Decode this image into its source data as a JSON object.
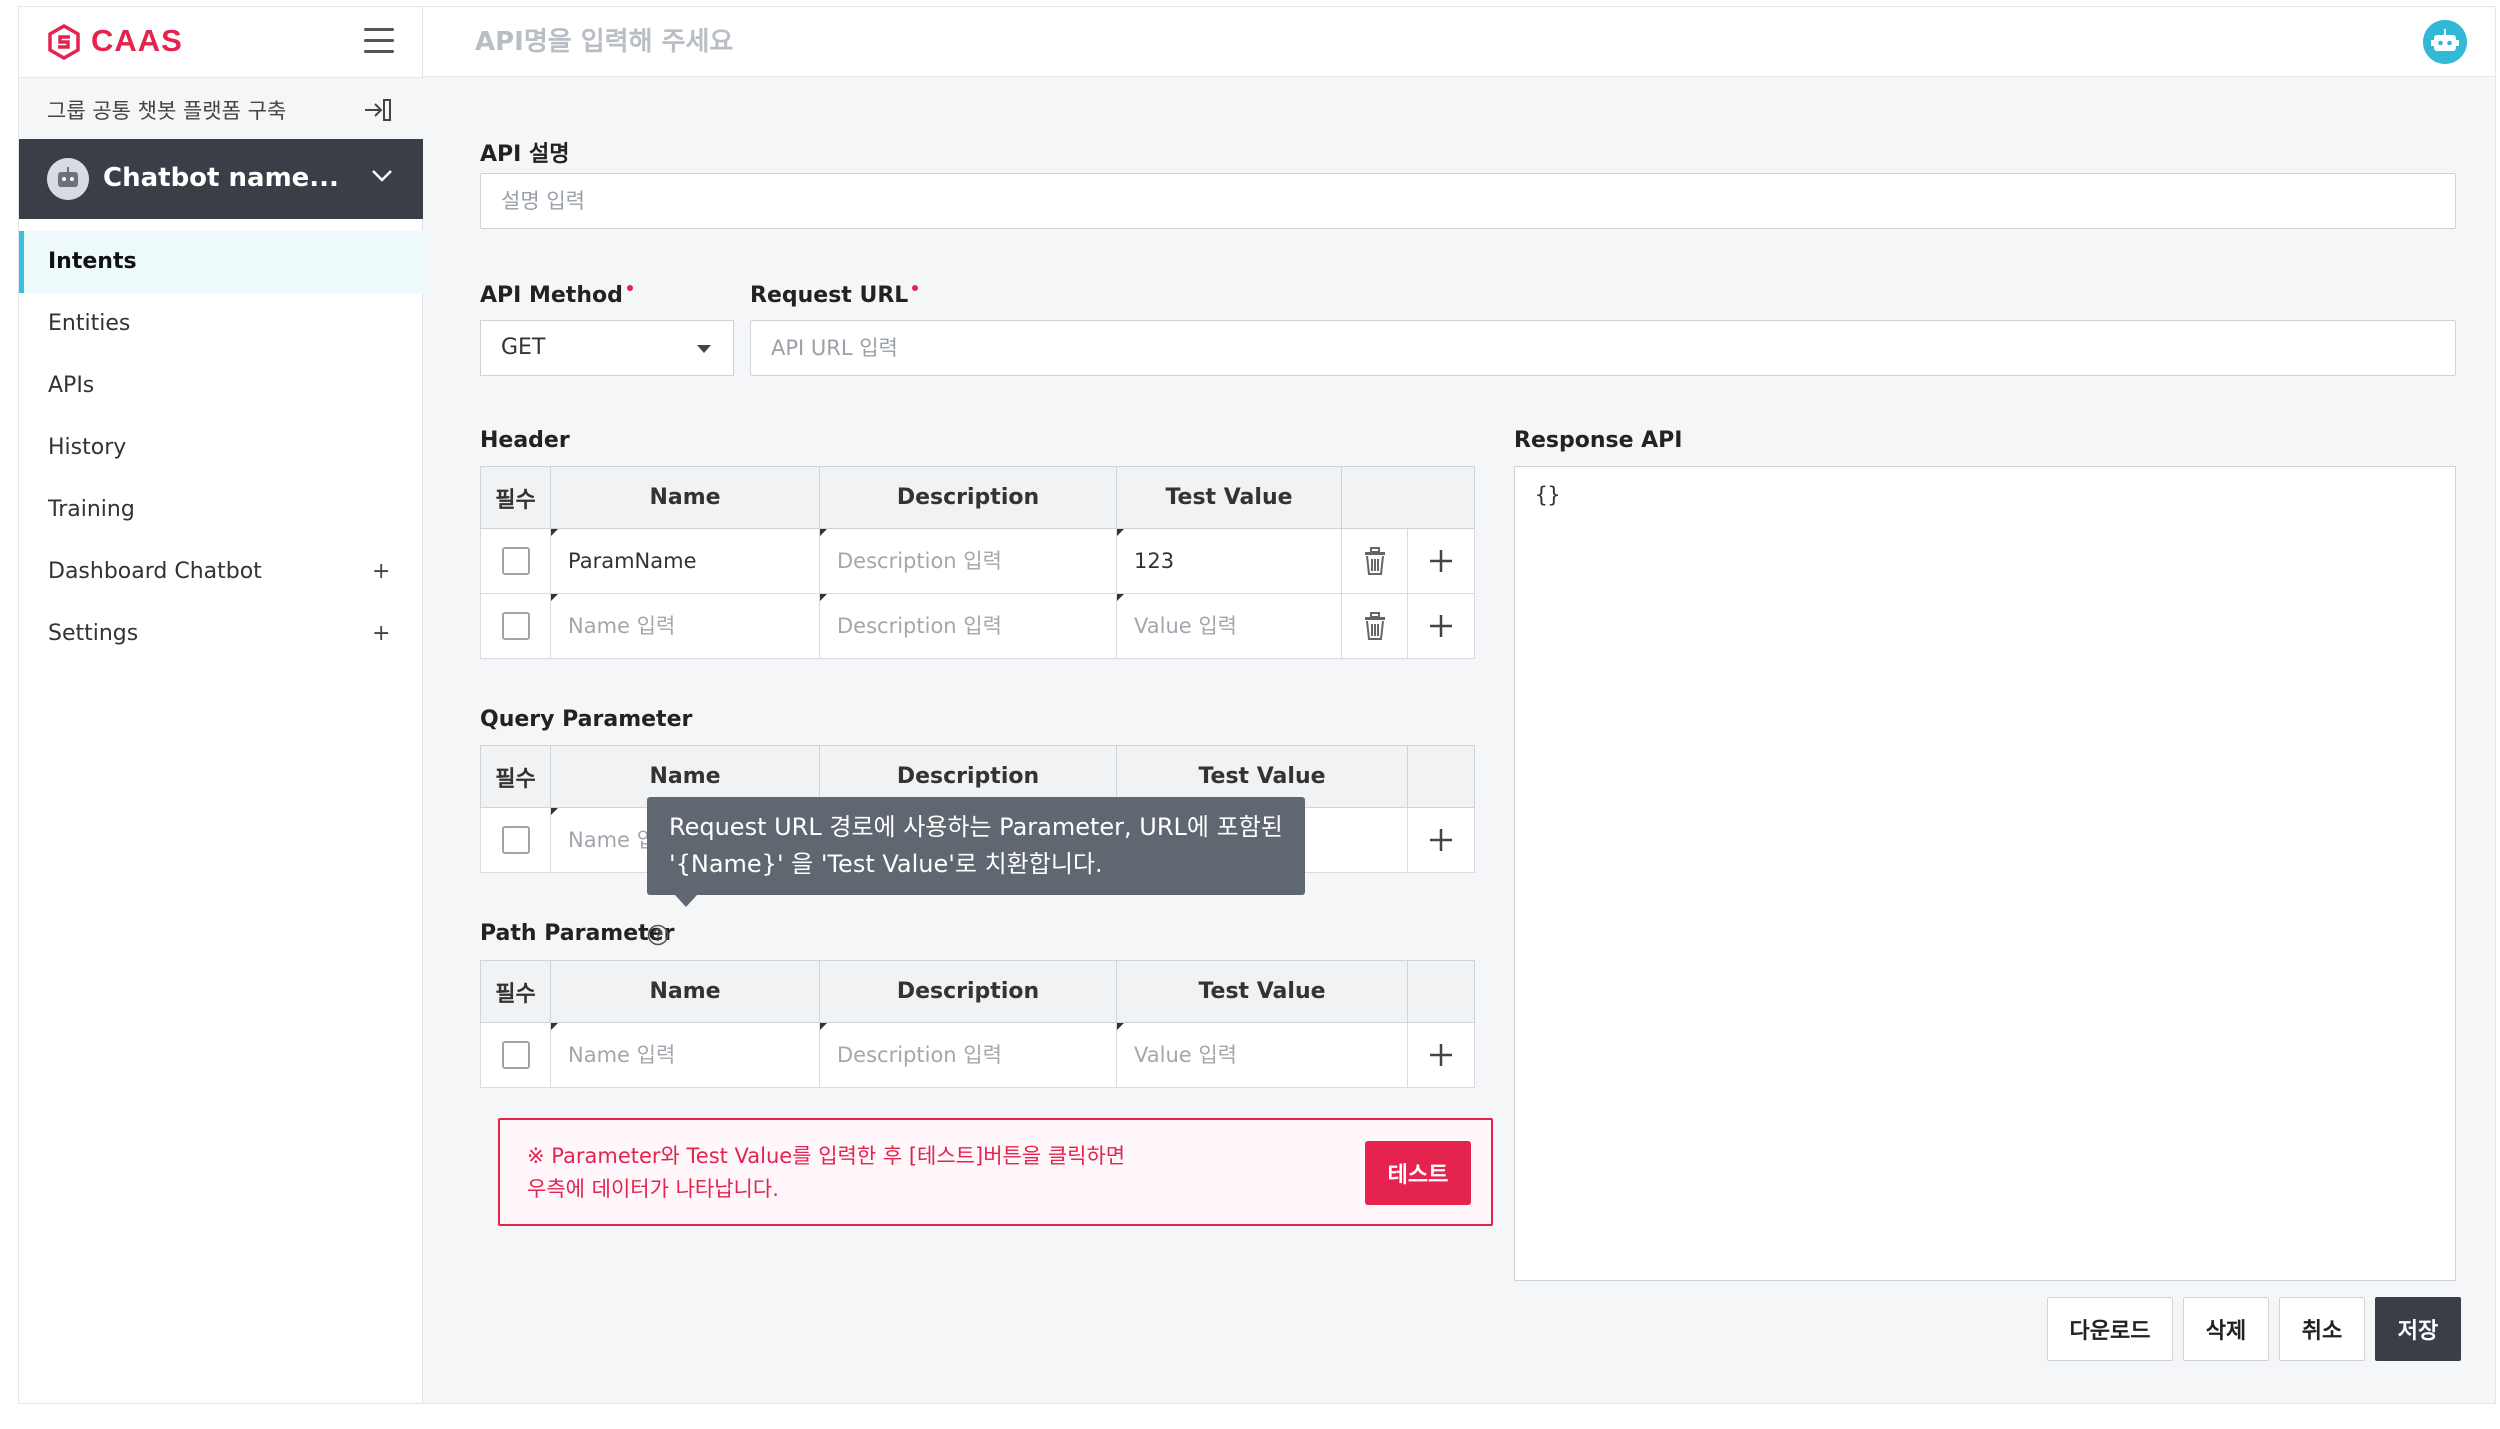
{
  "brand": {
    "name": "CAAS",
    "accent": "#e4234f"
  },
  "sidebar": {
    "project_name": "그룹 공통 챗봇 플랫폼 구축",
    "chatbot_name": "Chatbot name...",
    "items": [
      {
        "label": "Intents",
        "active": true,
        "expandable": false
      },
      {
        "label": "Entities",
        "active": false,
        "expandable": false
      },
      {
        "label": "APIs",
        "active": false,
        "expandable": false
      },
      {
        "label": "History",
        "active": false,
        "expandable": false
      },
      {
        "label": "Training",
        "active": false,
        "expandable": false
      },
      {
        "label": "Dashboard Chatbot",
        "active": false,
        "expandable": true,
        "plus": "+"
      },
      {
        "label": "Settings",
        "active": false,
        "expandable": true,
        "plus": "+"
      }
    ]
  },
  "header": {
    "api_name_placeholder": "API명을 입력해 주세요"
  },
  "form": {
    "description_label": "API 설명",
    "description_placeholder": "설명 입력",
    "method_label": "API Method",
    "method_value": "GET",
    "url_label": "Request URL",
    "url_placeholder": "API URL 입력"
  },
  "columns": {
    "required": "필수",
    "name": "Name",
    "description": "Description",
    "test_value": "Test Value"
  },
  "header_params": {
    "title": "Header",
    "rows": [
      {
        "name": "ParamName",
        "description": "",
        "value": "123"
      },
      {
        "name": "",
        "description": "",
        "value": ""
      }
    ]
  },
  "query_params": {
    "title": "Query Parameter",
    "rows": [
      {
        "name": "",
        "description": "",
        "value": ""
      }
    ]
  },
  "path_params": {
    "title": "Path Parameter",
    "rows": [
      {
        "name": "",
        "description": "",
        "value": ""
      }
    ]
  },
  "placeholders": {
    "name": "Name 입력",
    "description": "Description 입력",
    "value": "Value 입력"
  },
  "tooltip": {
    "line1": "Request URL 경로에 사용하는 Parameter, URL에 포함된",
    "line2": "'{Name}' 을 'Test Value'로 치환합니다."
  },
  "notice": {
    "line1": "※ Parameter와 Test Value를 입력한 후 [테스트]버튼을 클릭하면",
    "line2": "우측에 데이터가 나타납니다.",
    "test_button": "테스트"
  },
  "response": {
    "title": "Response API",
    "value": "{}"
  },
  "actions": {
    "download": "다운로드",
    "delete": "삭제",
    "cancel": "취소",
    "save": "저장"
  }
}
